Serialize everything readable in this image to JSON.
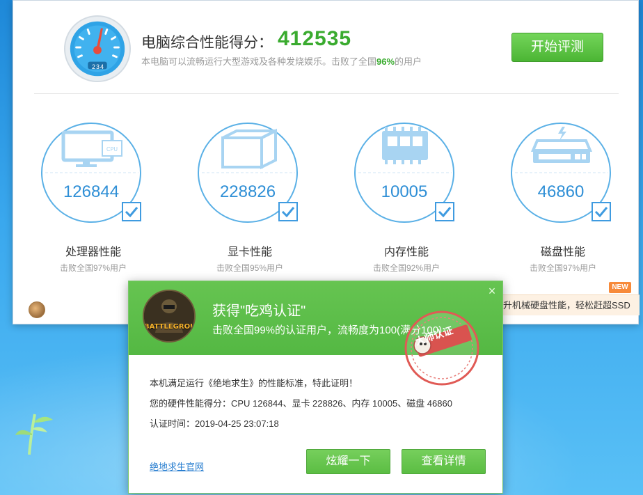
{
  "main": {
    "score_title": "电脑综合性能得分：",
    "score_value": "412535",
    "score_sub_prefix": "本电脑可以流畅运行大型游戏及各种发烧娱乐。击败了全国",
    "score_sub_pct": "96%",
    "score_sub_suffix": "的用户",
    "gauge_reading": "234",
    "start_button": "开始评测"
  },
  "metrics": [
    {
      "icon": "monitor-cpu-icon",
      "icon_text": "CPU",
      "value": "126844",
      "label": "处理器性能",
      "sub": "击败全国97%用户"
    },
    {
      "icon": "graphics-card-icon",
      "value": "228826",
      "label": "显卡性能",
      "sub": "击败全国95%用户"
    },
    {
      "icon": "memory-chip-icon",
      "value": "10005",
      "label": "内存性能",
      "sub": "击败全国92%用户"
    },
    {
      "icon": "hard-disk-icon",
      "value": "46860",
      "label": "磁盘性能",
      "sub": "击败全国97%用户"
    }
  ],
  "promo": {
    "badge": "NEW",
    "text": "升机械硬盘性能，轻松赶超SSD"
  },
  "popup": {
    "title": "获得\"吃鸡认证\"",
    "subtitle": "击败全国99%的认证用户，流畅度为100(满分100)",
    "stamp": "大师认证",
    "logo_text": "BATTLEGROUNDS",
    "line1": "本机满足运行《绝地求生》的性能标准，特此证明！",
    "line2": "您的硬件性能得分：CPU 126844、显卡 228826、内存 10005、磁盘 46860",
    "line3": "认证时间：2019-04-25 23:07:18",
    "link": "绝地求生官网",
    "btn_share": "炫耀一下",
    "btn_detail": "查看详情",
    "close_icon": "×"
  },
  "colors": {
    "accent_blue": "#2f8fd6",
    "ring_blue": "#5ab0e6",
    "score_green": "#3aab2f",
    "button_green": "#5bbd43",
    "popup_green": "#5cbc47",
    "stamp_red": "#d9534f"
  }
}
